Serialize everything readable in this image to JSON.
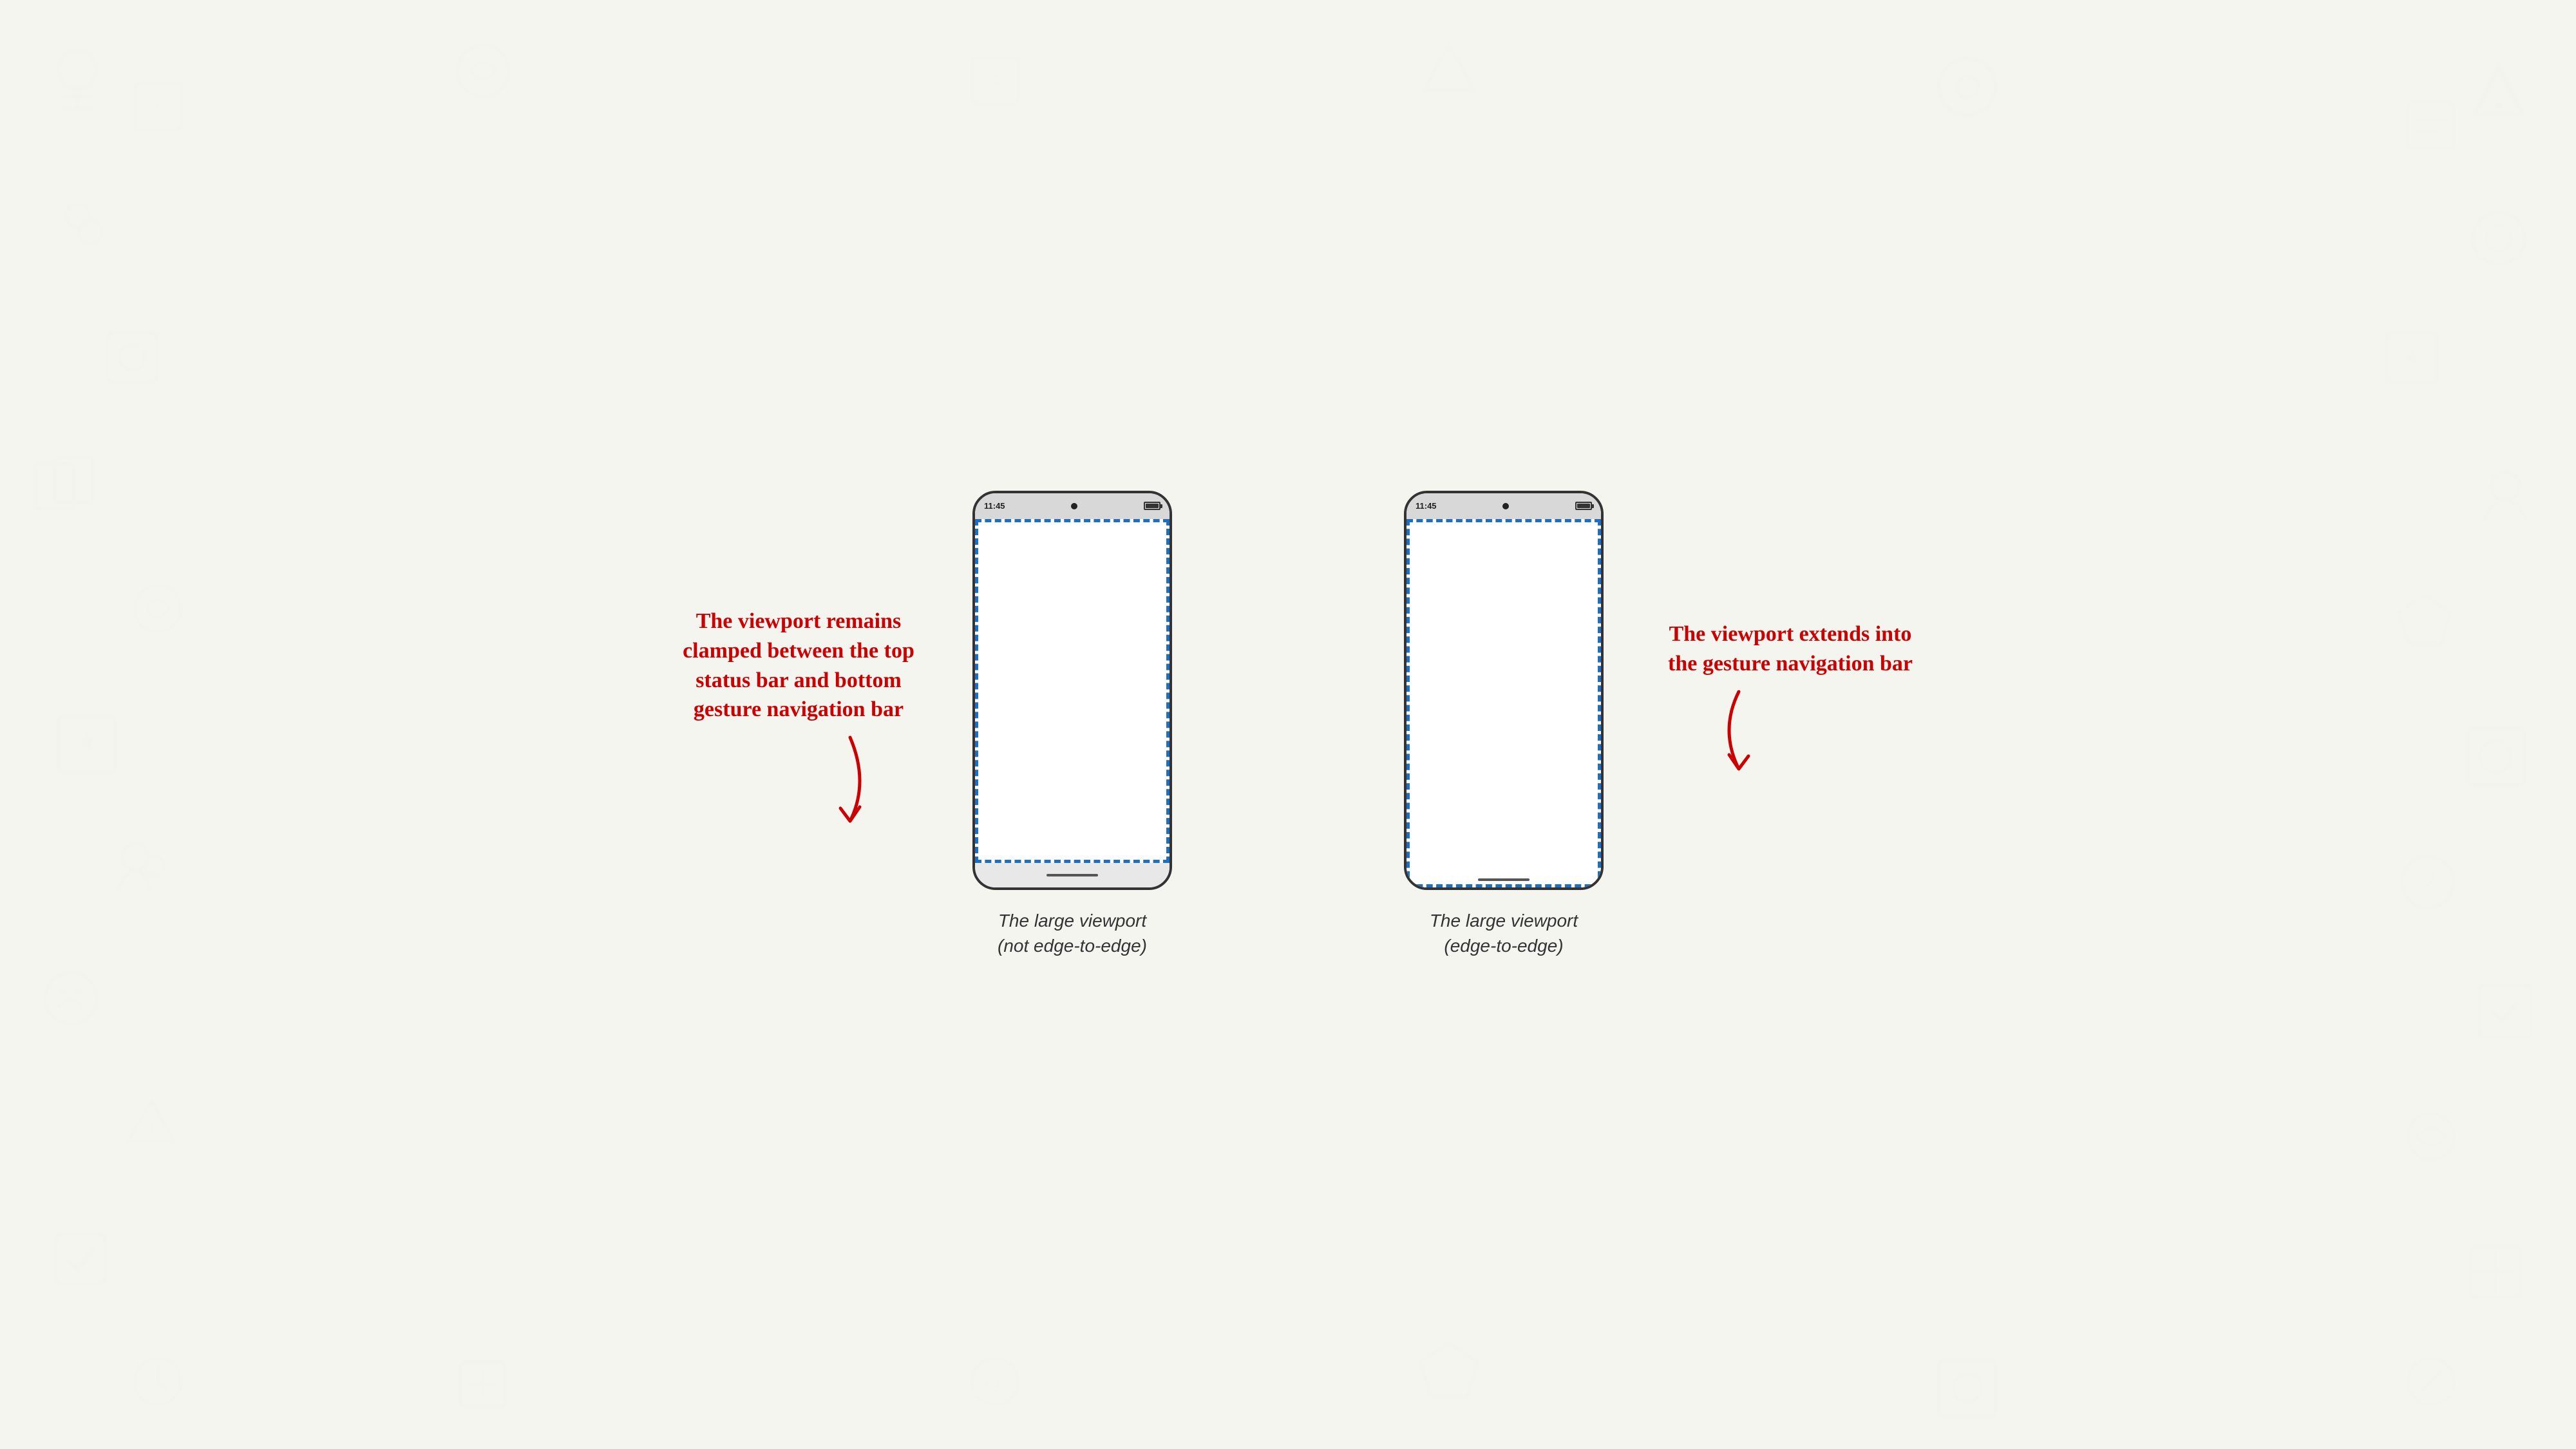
{
  "page": {
    "background_color": "#f5f5f0"
  },
  "phones": [
    {
      "id": "not-edge",
      "status_time": "11:45",
      "label_line1": "The large viewport",
      "label_line2": "(not edge-to-edge)",
      "edge_to_edge": false
    },
    {
      "id": "edge",
      "status_time": "11:45",
      "label_line1": "The large viewport",
      "label_line2": "(edge-to-edge)",
      "edge_to_edge": true
    }
  ],
  "annotations": {
    "left": {
      "text": "The viewport remains clamped between the top status bar and bottom gesture navigation bar"
    },
    "right": {
      "text": "The viewport extends into the gesture navigation bar"
    }
  }
}
